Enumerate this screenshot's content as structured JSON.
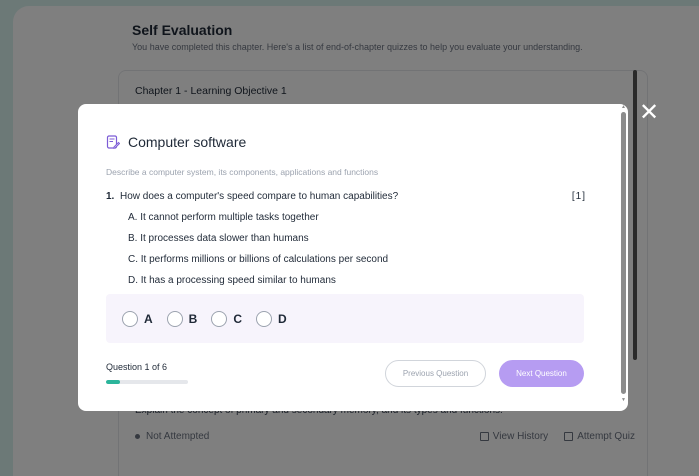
{
  "page": {
    "title": "Self Evaluation",
    "subtitle": "You have completed this chapter. Here's a list of end-of-chapter quizzes to help you evaluate your understanding.",
    "chapter_title": "Chapter 1 - Learning Objective 1",
    "quiz_description": "Explain the concept of primary and secondary memory, and its types and functions.",
    "status": "Not Attempted",
    "view_history_label": "View History",
    "attempt_quiz_label": "Attempt Quiz"
  },
  "modal": {
    "close_icon": "close-icon",
    "title_icon": "document-edit-icon",
    "title": "Computer software",
    "description": "Describe a computer system, its components, applications and functions",
    "question": {
      "number": "1.",
      "text": "How does a computer's speed compare to human capabilities?",
      "marks": "[1]",
      "options": [
        "A. It cannot perform multiple tasks together",
        "B. It processes data slower than humans",
        "C. It performs millions or billions of calculations per second",
        "D. It has a processing speed similar to humans"
      ]
    },
    "answer_choices": [
      "A",
      "B",
      "C",
      "D"
    ],
    "progress_text": "Question 1 of 6",
    "progress_fraction": 0.1667,
    "prev_label": "Previous Question",
    "next_label": "Next Question",
    "colors": {
      "accent": "#b69cf2",
      "progress": "#2bb59b",
      "answer_bg": "#f7f4fc",
      "icon": "#7c5cd6"
    }
  }
}
